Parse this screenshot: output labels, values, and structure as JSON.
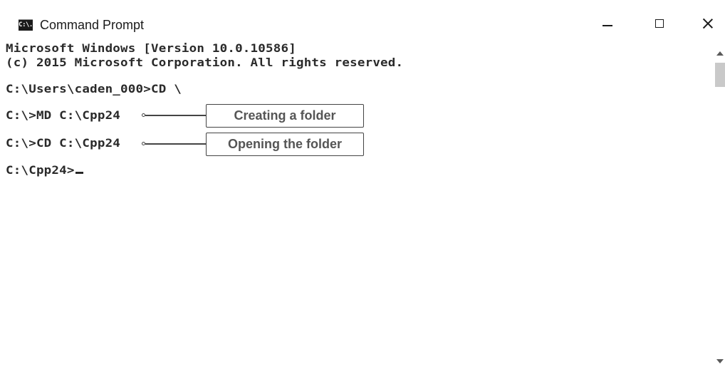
{
  "window": {
    "title": "Command Prompt",
    "icon_label": "C:\\."
  },
  "console": {
    "lines": [
      "Microsoft Windows [Version 10.0.10586]",
      "(c) 2015 Microsoft Corporation. All rights reserved.",
      "C:\\Users\\caden_000>CD \\",
      "C:\\>MD C:\\Cpp24",
      "C:\\>CD C:\\Cpp24",
      "C:\\Cpp24>"
    ]
  },
  "annotations": {
    "create": "Creating a folder",
    "open": "Opening the folder"
  },
  "icons": {
    "app": "cmd-icon",
    "minimize": "minimize-icon",
    "maximize": "maximize-icon",
    "close": "close-icon",
    "scroll_up": "scroll-up-arrow-icon",
    "scroll_down": "scroll-down-arrow-icon"
  }
}
